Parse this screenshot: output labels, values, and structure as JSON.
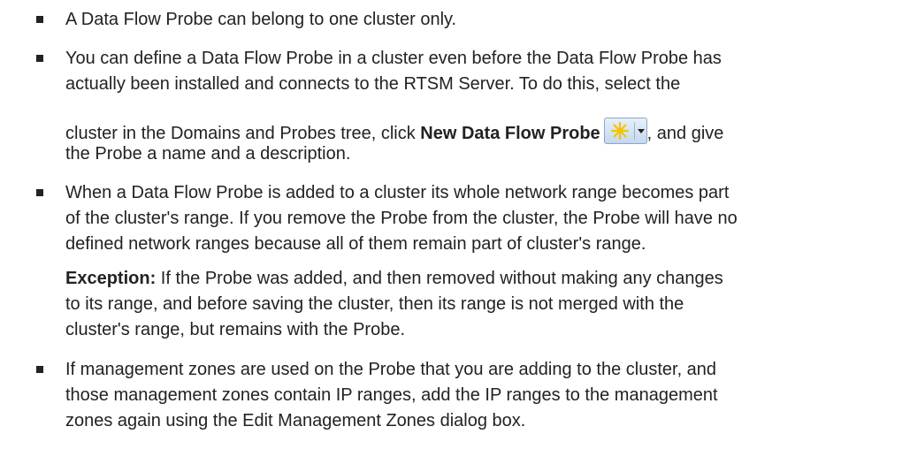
{
  "bullets": [
    {
      "lines": [
        "A Data Flow Probe can belong to one cluster only."
      ]
    },
    {
      "line1": "You can define a Data Flow Probe in a cluster even before the Data Flow Probe has",
      "line2": "actually been installed and connects to the RTSM Server. To do this, select the",
      "line3_pre": "cluster in the Domains and Probes tree, click ",
      "line3_bold": "New Data Flow Probe",
      "line3_post": ", and give",
      "line4": "the Probe a name and a description.",
      "button_icon": "sun-star-icon"
    },
    {
      "line1": "When a Data Flow Probe is added to a cluster its whole network range becomes part",
      "line2": "of the cluster's range. If you remove the Probe from the cluster, the Probe will have no",
      "line3": "defined network ranges because all of them remain part of cluster's range.",
      "exception_label": "Exception:",
      "exception_line1": " If the Probe was added, and then removed without making any changes",
      "exception_line2": "to its range, and before saving the cluster, then its range is not merged with the",
      "exception_line3": "cluster's range, but remains with the Probe."
    },
    {
      "line1": "If management zones are used on the Probe that you are adding to the cluster, and",
      "line2": "those management zones contain IP ranges, add the IP ranges to the management",
      "line3": "zones again using the Edit Management Zones dialog box."
    }
  ],
  "colors": {
    "text": "#222222",
    "button_bg": "#c5d8ee",
    "icon": "#f5c400"
  }
}
